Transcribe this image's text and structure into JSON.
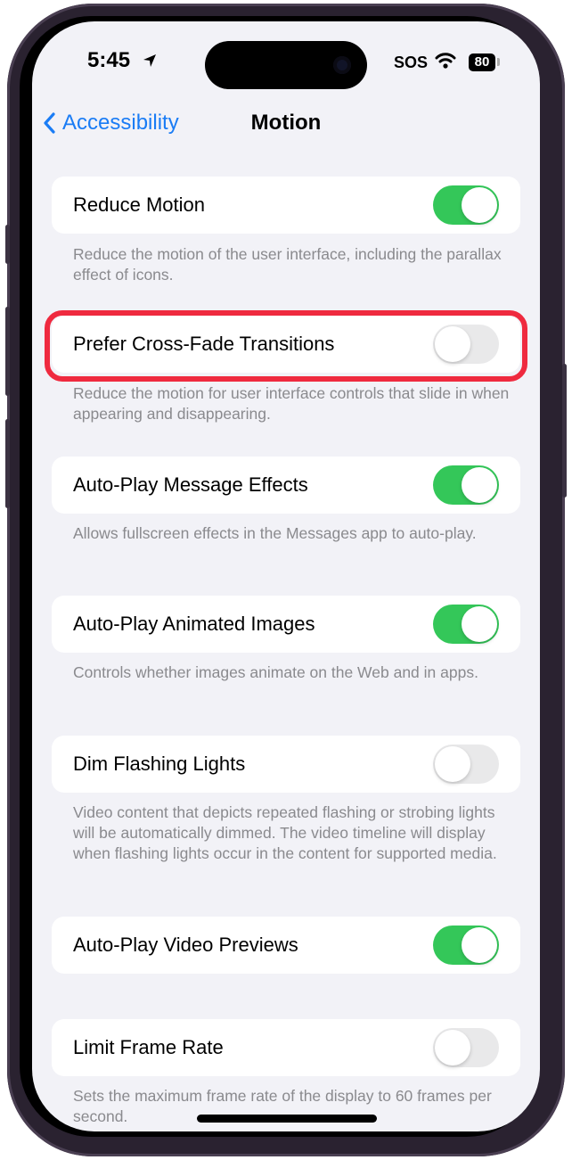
{
  "status_bar": {
    "time": "5:45",
    "carrier": "SOS",
    "battery": "80"
  },
  "nav": {
    "back_label": "Accessibility",
    "title": "Motion"
  },
  "settings": [
    {
      "label": "Reduce Motion",
      "on": true,
      "footer": "Reduce the motion of the user interface, including the parallax effect of icons."
    },
    {
      "label": "Prefer Cross-Fade Transitions",
      "on": false,
      "highlighted": true,
      "footer": "Reduce the motion for user interface controls that slide in when appearing and disappearing."
    },
    {
      "label": "Auto-Play Message Effects",
      "on": true,
      "footer": "Allows fullscreen effects in the Messages app to auto-play."
    },
    {
      "label": "Auto-Play Animated Images",
      "on": true,
      "footer": "Controls whether images animate on the Web and in apps."
    },
    {
      "label": "Dim Flashing Lights",
      "on": false,
      "footer": "Video content that depicts repeated flashing or strobing lights will be automatically dimmed. The video timeline will display when flashing lights occur in the content for supported media."
    },
    {
      "label": "Auto-Play Video Previews",
      "on": true,
      "footer": ""
    },
    {
      "label": "Limit Frame Rate",
      "on": false,
      "footer": "Sets the maximum frame rate of the display to 60 frames per second."
    }
  ],
  "colors": {
    "accent": "#1a7cf5",
    "toggle_on": "#34c759",
    "toggle_off": "#e9e9ea",
    "highlight": "#ef2a3f",
    "background": "#f2f2f7"
  }
}
